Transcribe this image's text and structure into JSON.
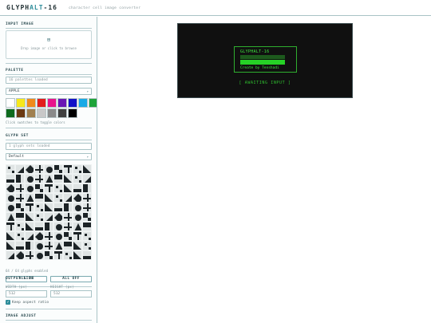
{
  "app": {
    "title_main": "GLYPH",
    "title_accent": "ALT",
    "title_suffix": "-16",
    "tagline": "character cell image converter"
  },
  "input_image": {
    "title": "INPUT IMAGE",
    "drop_icon": "⊞",
    "drop_text": "Drop image or click to browse"
  },
  "palette": {
    "title": "PALETTE",
    "status": "16 palettes loaded",
    "selected": "APPLE",
    "colors": [
      "#ffffff",
      "#f7e81b",
      "#f08a1c",
      "#e21d1d",
      "#e8148c",
      "#6a16b4",
      "#1212c8",
      "#19a9e6",
      "#1ea43a",
      "#0d6a1d",
      "#6b3a12",
      "#a08050",
      "#c8c8c8",
      "#8a8a8a",
      "#404040",
      "#000000"
    ],
    "hint": "Click swatches to toggle colors"
  },
  "glyph_set": {
    "title": "GLYPH SET",
    "status": "1 glyph sets loaded",
    "selected": "Default",
    "enabled_text": "64 / 64 glyphs enabled",
    "all_on": "ALL ON",
    "all_off": "ALL OFF"
  },
  "output_size": {
    "title": "OUTPUT SIZE",
    "width_label": "WIDTH (px)",
    "height_label": "HEIGHT (px)",
    "width_value": "512",
    "height_value": "512",
    "keep_aspect": "Keep aspect ratio"
  },
  "image_adjust": {
    "title": "IMAGE ADJUST"
  },
  "preview": {
    "title": "GLYPHALT-16",
    "credit": "Create by Tenshadi",
    "status": "[ AWAITING INPUT ]"
  }
}
